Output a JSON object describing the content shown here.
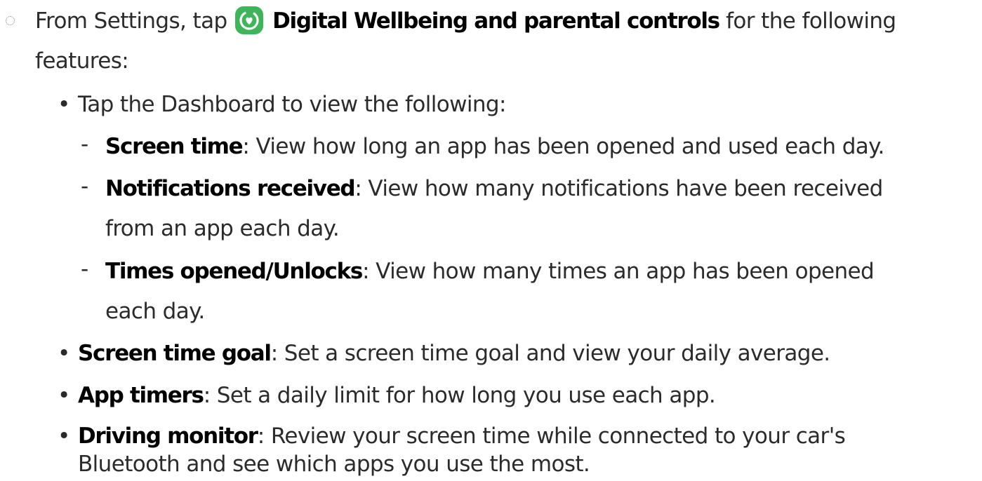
{
  "intro": {
    "prefix": "From Settings, tap",
    "app_name": "Digital Wellbeing and parental controls",
    "suffix": "for the following",
    "line2": "features:",
    "icon": "digital-wellbeing-icon",
    "icon_color": "#3fb55a"
  },
  "dashboard": {
    "text": "Tap the Dashboard to view the following:",
    "items": [
      {
        "term": "Screen time",
        "desc": ": View how long an app has been opened and used each day."
      },
      {
        "term": "Notifications received",
        "desc": ": View how many notifications have been received",
        "desc2": "from an app each day."
      },
      {
        "term": "Times opened/Unlocks",
        "desc": ": View how many times an app has been opened",
        "desc2": "each day."
      }
    ]
  },
  "features": [
    {
      "term": "Screen time goal",
      "desc": ": Set a screen time goal and view your daily average."
    },
    {
      "term": "App timers",
      "desc": ": Set a daily limit for how long you use each app."
    },
    {
      "term": "Driving monitor",
      "desc": ": Review your screen time while connected to your car's",
      "desc2": "Bluetooth and see which apps you use the most."
    }
  ],
  "symbols": {
    "bullet": "•",
    "dash": "-"
  }
}
